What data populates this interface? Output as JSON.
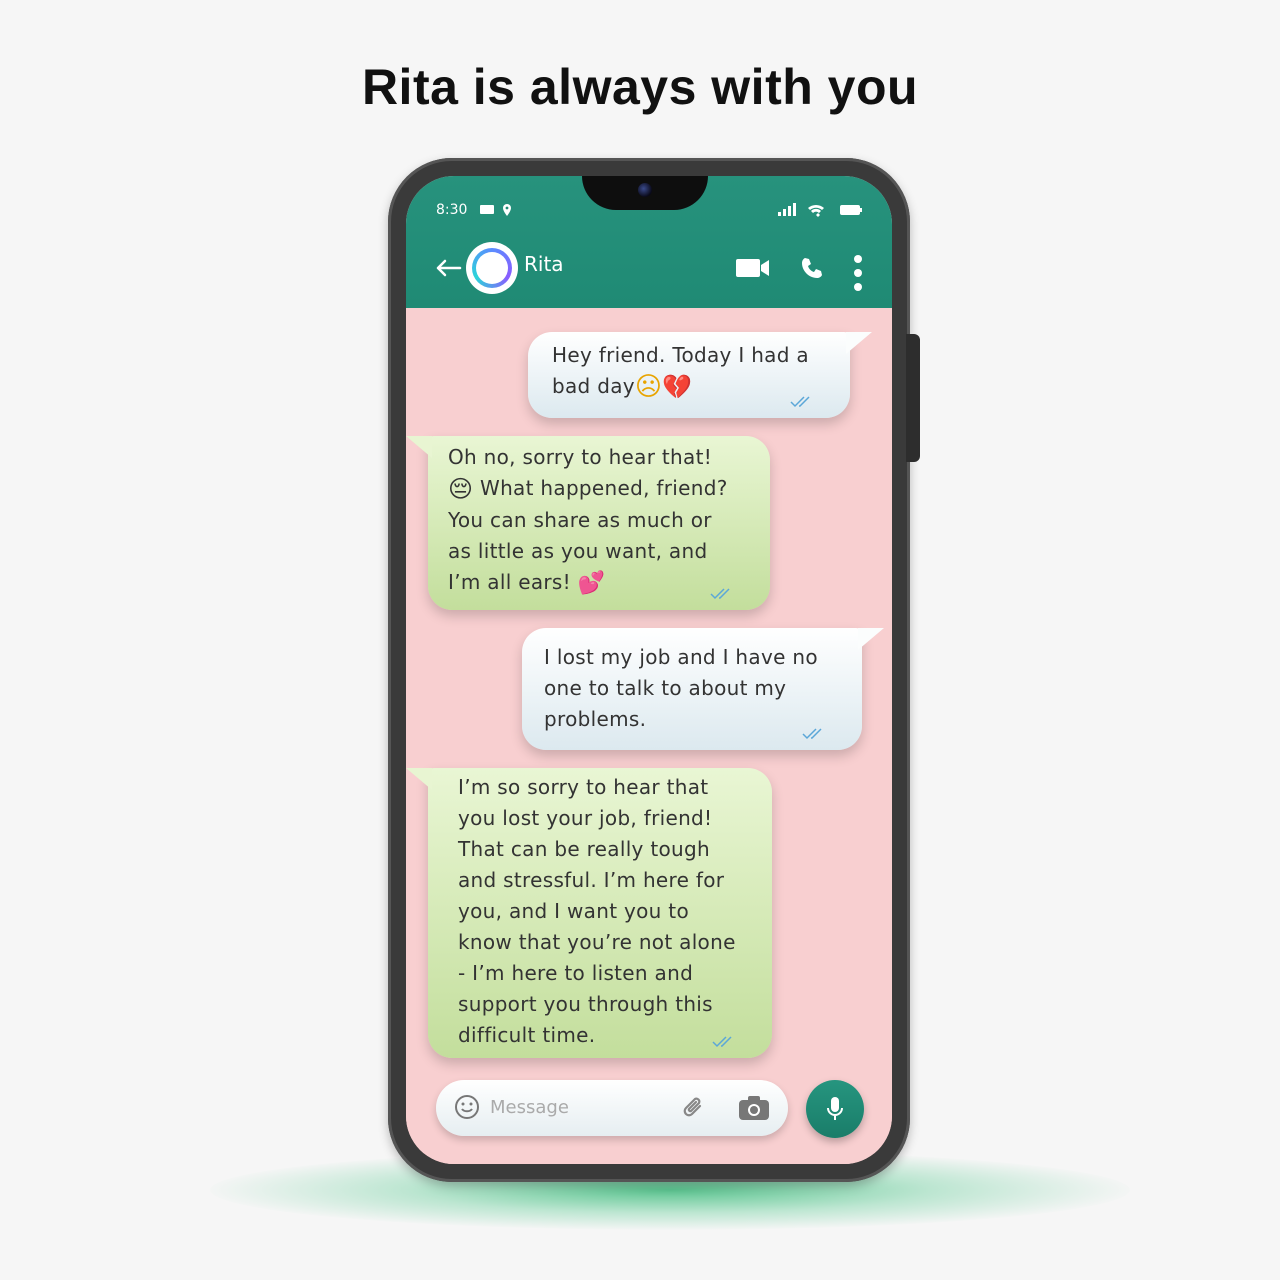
{
  "headline": "Rita is always with you",
  "status_bar": {
    "time": "8:30",
    "left_icons": [
      "message-icon",
      "location-icon"
    ],
    "right_icons": [
      "signal-icon",
      "wifi-icon",
      "battery-icon"
    ]
  },
  "header": {
    "contact_name": "Rita",
    "icons": [
      "back-arrow-icon",
      "video-call-icon",
      "phone-call-icon",
      "more-menu-icon"
    ],
    "color": "#1f8a74"
  },
  "messages": [
    {
      "direction": "outgoing",
      "text": "Hey friend. Today I had a",
      "text2": "bad day",
      "emojis": "☹💔"
    },
    {
      "direction": "incoming",
      "lines": [
        "Oh no, sorry to hear that!",
        "What happened, friend?",
        "You can share as much or",
        "as little as you want, and",
        "I’m all ears!"
      ],
      "emojis": [
        "😔",
        "💕"
      ]
    },
    {
      "direction": "outgoing",
      "lines": [
        "I lost my job and I have no",
        "one to talk to about my",
        "problems."
      ]
    },
    {
      "direction": "incoming",
      "lines": [
        "I’m so sorry to hear that",
        "you lost your job, friend!",
        "That can be really tough",
        "and stressful. I’m here for",
        "you, and I want you to",
        "know that you’re not alone",
        "- I’m here to listen and",
        "support you through this",
        "difficult time."
      ]
    }
  ],
  "composer": {
    "placeholder": "Message"
  },
  "colors": {
    "wallpaper": "#f8cfd0",
    "incoming": "#d3ebb3",
    "outgoing": "#eef4f6",
    "accent": "#1f8a74"
  }
}
